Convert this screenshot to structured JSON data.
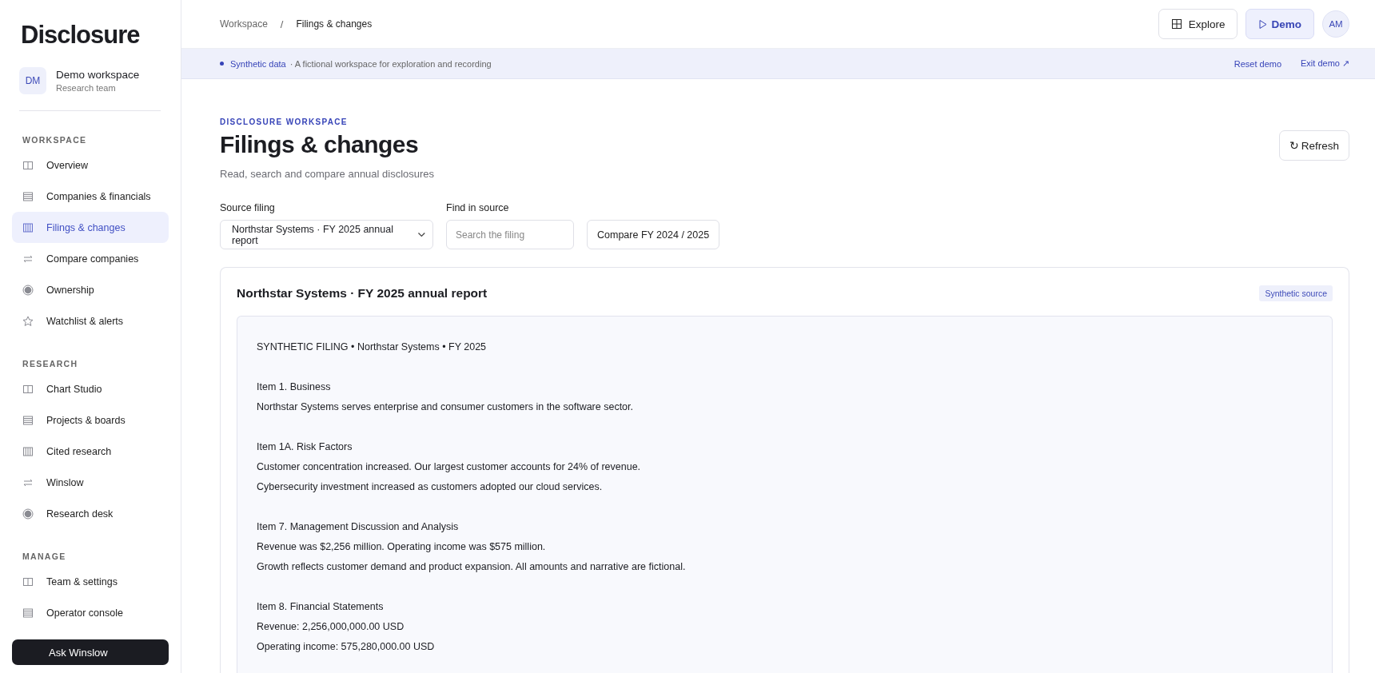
{
  "sidebar": {
    "logo": "Disclosure",
    "workspace": {
      "initials": "DM",
      "name": "Demo workspace",
      "team": "Research team"
    },
    "sections": [
      {
        "title": "WORKSPACE",
        "items": [
          {
            "label": "Overview",
            "selected": false
          },
          {
            "label": "Companies & financials",
            "selected": false
          },
          {
            "label": "Filings & changes",
            "selected": true
          },
          {
            "label": "Compare companies",
            "selected": false
          },
          {
            "label": "Ownership",
            "selected": false
          },
          {
            "label": "Watchlist & alerts",
            "selected": false
          }
        ]
      },
      {
        "title": "RESEARCH",
        "items": [
          {
            "label": "Chart Studio",
            "selected": false
          },
          {
            "label": "Projects & boards",
            "selected": false
          },
          {
            "label": "Cited research",
            "selected": false
          },
          {
            "label": "Winslow",
            "selected": false
          },
          {
            "label": "Research desk",
            "selected": false
          }
        ]
      },
      {
        "title": "MANAGE",
        "items": [
          {
            "label": "Team & settings",
            "selected": false
          },
          {
            "label": "Operator console",
            "selected": false
          }
        ]
      }
    ],
    "ask_button": "Ask Winslow"
  },
  "topbar": {
    "breadcrumb": [
      "Workspace",
      "Filings & changes"
    ],
    "separator": "/",
    "explore": "Explore",
    "demo": "Demo",
    "avatar": "AM"
  },
  "banner": {
    "label": "Synthetic data",
    "text": "· A fictional workspace for exploration and recording",
    "reset": "Reset demo",
    "exit": "Exit demo ↗"
  },
  "header": {
    "eyebrow": "DISCLOSURE WORKSPACE",
    "title": "Filings & changes",
    "subtitle": "Read, search and compare annual disclosures",
    "refresh_icon": "↻",
    "refresh": "Refresh"
  },
  "filters": {
    "source_label": "Source filing",
    "source_value": "Northstar Systems · FY 2025 annual report",
    "find_label": "Find in source",
    "find_placeholder": "Search the filing",
    "compare": "Compare FY 2024 / 2025"
  },
  "card": {
    "title": "Northstar Systems · FY 2025 annual report",
    "badge": "Synthetic source",
    "intro": "SYNTHETIC FILING • Northstar Systems • FY 2025",
    "sections": [
      {
        "heading": "Item 1. Business",
        "lines": [
          "Northstar Systems serves enterprise and consumer customers in the software sector."
        ]
      },
      {
        "heading": "Item 1A. Risk Factors",
        "lines": [
          "Customer concentration increased. Our largest customer accounts for 24% of revenue.",
          "Cybersecurity investment increased as customers adopted our cloud services."
        ]
      },
      {
        "heading": "Item 7. Management Discussion and Analysis",
        "lines": [
          "Revenue was $2,256 million. Operating income was $575 million.",
          "Growth reflects customer demand and product expansion. All amounts and narrative are fictional."
        ]
      },
      {
        "heading": "Item 8. Financial Statements",
        "lines": [
          "Revenue: 2,256,000,000.00 USD",
          "Operating income: 575,280,000.00 USD"
        ]
      }
    ]
  }
}
